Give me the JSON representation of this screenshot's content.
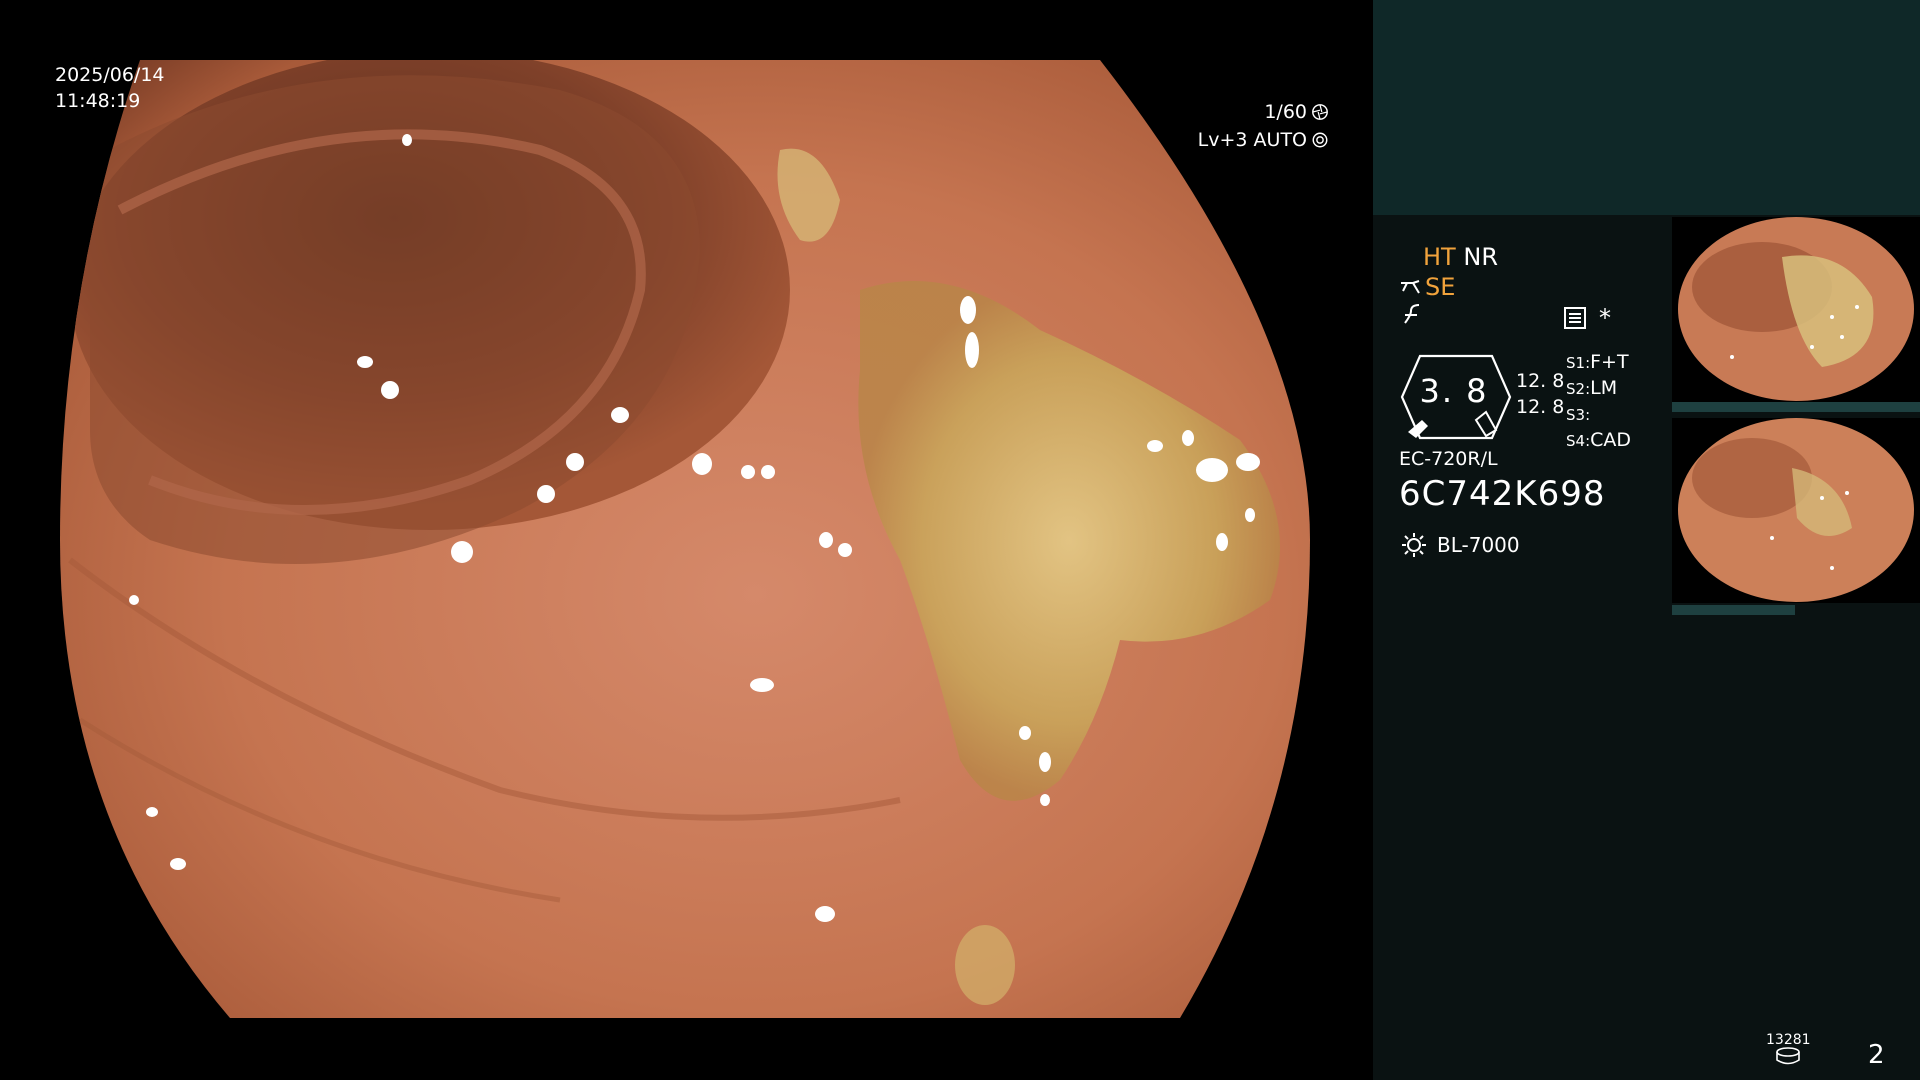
{
  "overlay": {
    "date": "2025/06/14",
    "time": "11:48:19",
    "shutter": "1/60",
    "level_mode": "Lv+3 AUTO",
    "shutter_icon": "aperture-icon",
    "mode_icon": "gear-icon"
  },
  "panel": {
    "mode_ht": "HT",
    "mode_nr": "NR",
    "mode_se": "SE",
    "se_icon": "scope-tip-icon",
    "enhance_icon": "filter-icon",
    "config_icon": "settings-list-icon",
    "asterisk": "*",
    "gauge_value": "3. 8",
    "gauge_num_1": "12. 8",
    "gauge_num_2": "12. 8",
    "slots": [
      {
        "key": "S1:",
        "value": "F+T"
      },
      {
        "key": "S2:",
        "value": "LM"
      },
      {
        "key": "S3:",
        "value": ""
      },
      {
        "key": "S4:",
        "value": "CAD"
      }
    ],
    "scope_model": "EC-720R/L",
    "scope_serial": "6C742K698",
    "light_source": "BL-7000",
    "light_icon": "lamp-icon"
  },
  "footer": {
    "image_counter": "13281",
    "page_number": "2",
    "storage_icon": "disk-icon"
  },
  "colors": {
    "accent_orange": "#f1a33c",
    "panel_bg": "#0a1212",
    "panel_top": "#0f2828",
    "mucosa": "#c97a55"
  }
}
